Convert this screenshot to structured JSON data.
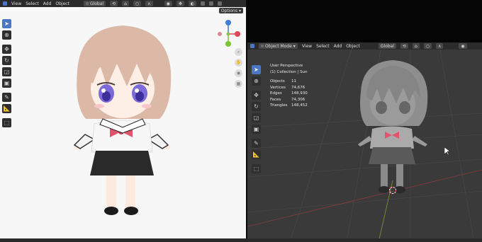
{
  "left_viewport": {
    "menu": [
      "View",
      "Select",
      "Add",
      "Object"
    ],
    "orientation": "Global",
    "options_label": "Options"
  },
  "right_viewport": {
    "mode": "Object Mode",
    "menu": [
      "View",
      "Select",
      "Add",
      "Object"
    ],
    "orientation": "Global",
    "overlay_title": "User Perspective",
    "overlay_collection": "(1) Collection | Sun",
    "stats": [
      {
        "key": "Objects",
        "value": "11"
      },
      {
        "key": "Vertices",
        "value": "74,676"
      },
      {
        "key": "Edges",
        "value": "148,930"
      },
      {
        "key": "Faces",
        "value": "74,306"
      },
      {
        "key": "Triangles",
        "value": "148,452"
      }
    ]
  },
  "gizmo": {
    "x_label": "X",
    "y_label": "Y",
    "z_label": "Z"
  },
  "colors": {
    "accent": "#4a76c4",
    "x_axis": "#e0455a",
    "y_axis": "#7cc430",
    "z_axis": "#3d7ed8"
  }
}
